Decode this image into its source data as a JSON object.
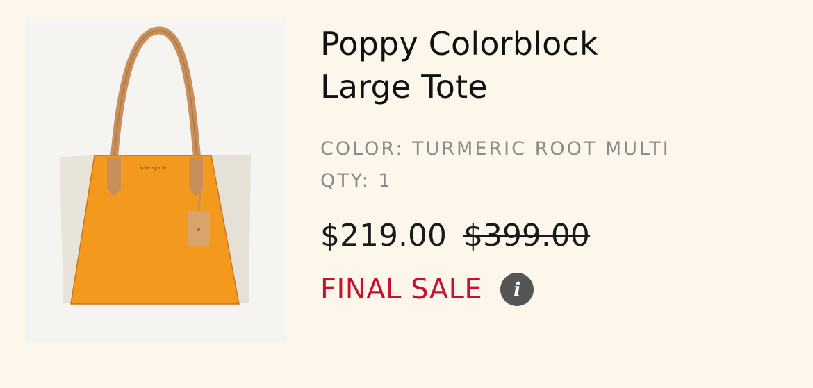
{
  "product": {
    "image_alt": "Poppy Colorblock Large Tote",
    "title": "Poppy Colorblock Large Tote",
    "color_line": "COLOR: TURMERIC ROOT MULTI",
    "qty_line": "QTY: 1",
    "sale_price": "$219.00",
    "original_price": "$399.00",
    "final_sale_label": "FINAL SALE",
    "info_icon_glyph": "i",
    "info_icon": "info-icon"
  },
  "colors": {
    "background": "#fcf7ea",
    "final_sale": "#c8102e",
    "bag_orange": "#f39a1e",
    "bag_side": "#e9e4da",
    "strap": "#c98f5a"
  }
}
